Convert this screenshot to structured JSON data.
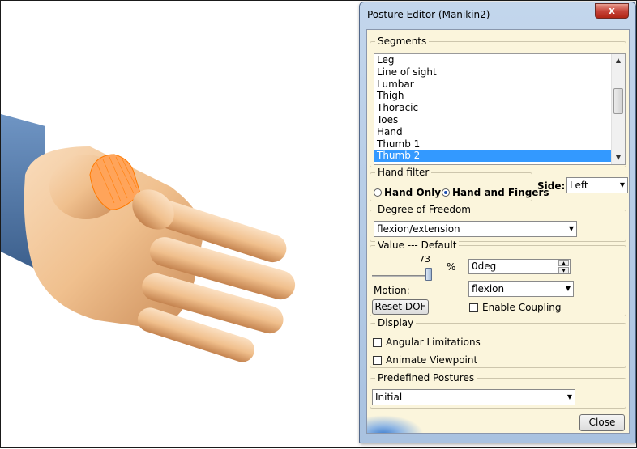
{
  "window": {
    "title": "Posture Editor (Manikin2)",
    "close_glyph": "x"
  },
  "segments": {
    "legend": "Segments",
    "items": [
      "Leg",
      "Line of sight",
      "Lumbar",
      "Thigh",
      "Thoracic",
      "Toes",
      "Hand",
      "Thumb 1",
      "Thumb 2"
    ],
    "selected": "Thumb 2"
  },
  "hand_filter": {
    "legend": "Hand filter",
    "options": [
      "Hand Only",
      "Hand and Fingers"
    ],
    "selected": "Hand and Fingers",
    "side_label": "Side:",
    "side_value": "Left"
  },
  "dof": {
    "legend": "Degree of Freedom",
    "value": "flexion/extension"
  },
  "value_group": {
    "legend": "Value --- Default",
    "slider_value": "73",
    "slider_fraction": 0.73,
    "percent_label": "%",
    "field_value": "0deg",
    "motion_label": "Motion:",
    "motion_value": "flexion",
    "reset_label": "Reset DOF",
    "coupling_label": "Enable Coupling",
    "coupling_checked": false
  },
  "display": {
    "legend": "Display",
    "angular_label": "Angular Limitations",
    "angular_checked": false,
    "animate_label": "Animate Viewpoint",
    "animate_checked": false
  },
  "postures": {
    "legend": "Predefined Postures",
    "value": "Initial"
  },
  "close_label": "Close",
  "colors": {
    "selection": "#3399ff",
    "panel": "#fbf5dc",
    "skin": "#f3c89a",
    "sleeve": "#4f78a8",
    "highlight": "#ff8a1c"
  },
  "icons": [
    "close-icon",
    "dropdown-arrow-icon",
    "scroll-up-icon",
    "scroll-down-icon",
    "spin-up-icon",
    "spin-down-icon",
    "app-logo-icon"
  ]
}
